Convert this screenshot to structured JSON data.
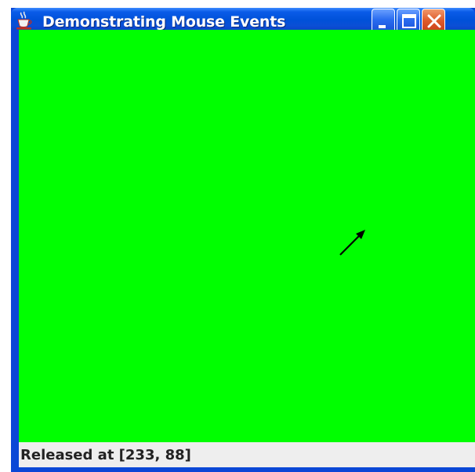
{
  "window": {
    "title": "Demonstrating Mouse Events",
    "app_icon": "java-cup-icon",
    "controls": {
      "minimize_icon": "minimize-icon",
      "maximize_icon": "maximize-icon",
      "close_icon": "close-icon"
    }
  },
  "canvas": {
    "background_color": "#00ff00"
  },
  "status": {
    "text": "Released at [233, 88]"
  },
  "cursor": {
    "icon": "arrow-pointer-icon"
  },
  "colors": {
    "titlebar": "#0051d9",
    "frame": "#0b47d6",
    "close_button": "#df5a2a",
    "statusbar": "#eeeeee"
  }
}
